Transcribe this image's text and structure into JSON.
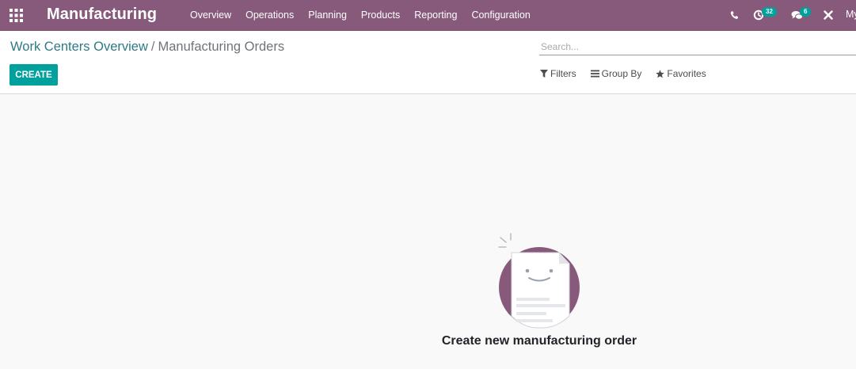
{
  "navbar": {
    "brand": "Manufacturing",
    "menu": [
      {
        "label": "Overview"
      },
      {
        "label": "Operations"
      },
      {
        "label": "Planning"
      },
      {
        "label": "Products"
      },
      {
        "label": "Reporting"
      },
      {
        "label": "Configuration"
      }
    ],
    "systray": {
      "activity_count": "32",
      "messages_count": "6",
      "user_label": "My"
    }
  },
  "control_panel": {
    "breadcrumb": {
      "parent": "Work Centers Overview",
      "separator": "/",
      "current": "Manufacturing Orders"
    },
    "create_label": "CREATE",
    "search_placeholder": "Search...",
    "filters_label": "Filters",
    "group_by_label": "Group By",
    "favorites_label": "Favorites"
  },
  "helper": {
    "title": "Create new manufacturing order"
  },
  "colors": {
    "navbar": "#875a7b",
    "accent": "#00a09d",
    "link": "#2e7a86"
  }
}
